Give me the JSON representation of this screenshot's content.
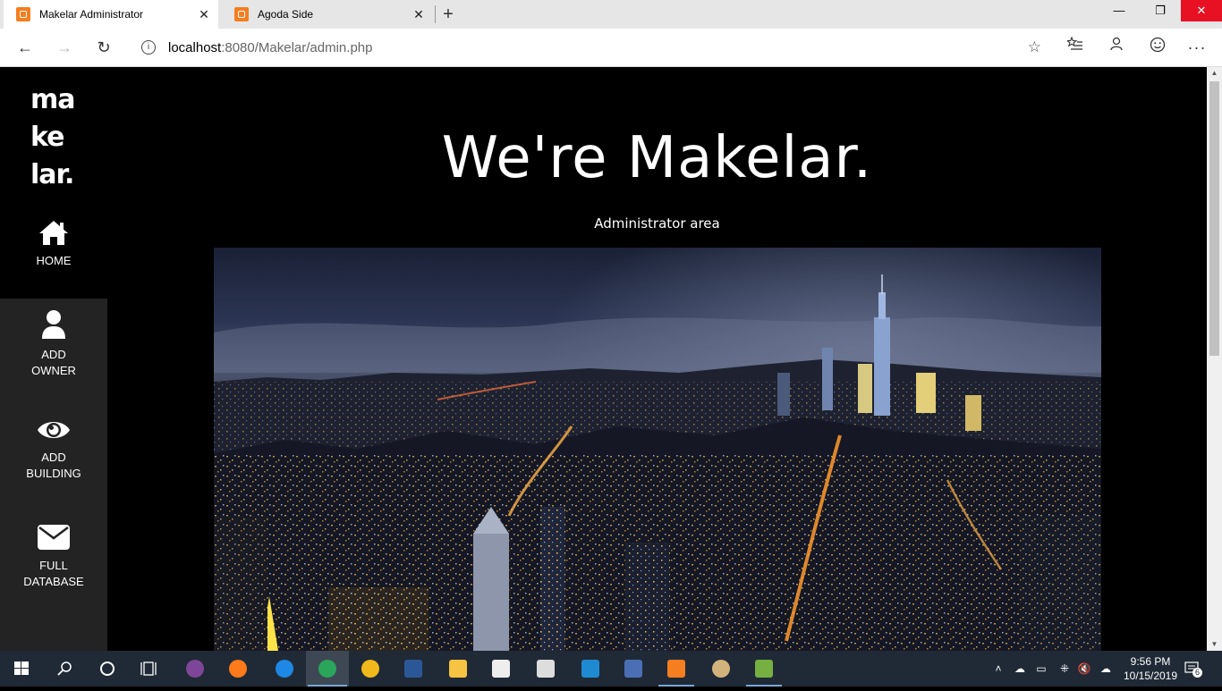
{
  "browser": {
    "tabs": [
      {
        "title": "Makelar Administrator",
        "active": true
      },
      {
        "title": "Agoda Side",
        "active": false
      }
    ],
    "url_host": "localhost",
    "url_rest": ":8080/Makelar/admin.php",
    "colors": {
      "tab_favicon": "#f47e20",
      "close_button": "#e81123"
    }
  },
  "sidebar": {
    "logo_lines": [
      "ma",
      "ke",
      "lar."
    ],
    "items": [
      {
        "label": "HOME",
        "icon": "home-icon"
      },
      {
        "label_lines": [
          "ADD",
          "OWNER"
        ],
        "icon": "user-icon"
      },
      {
        "label_lines": [
          "ADD",
          "BUILDING"
        ],
        "icon": "eye-icon"
      },
      {
        "label_lines": [
          "FULL",
          "DATABASE"
        ],
        "icon": "envelope-icon"
      }
    ]
  },
  "main": {
    "title": "We're Makelar.",
    "subtitle": "Administrator area",
    "hero_image": "night-city-skyline"
  },
  "taskbar": {
    "time": "9:56 PM",
    "date": "10/15/2019",
    "notification_count": "6",
    "apps": [
      "start",
      "search",
      "cortana",
      "task-view",
      "tor",
      "firefox",
      "edge",
      "devc",
      "canary",
      "word",
      "file-explorer",
      "store",
      "mail",
      "vscode",
      "network-app",
      "xampp",
      "paint"
    ]
  }
}
